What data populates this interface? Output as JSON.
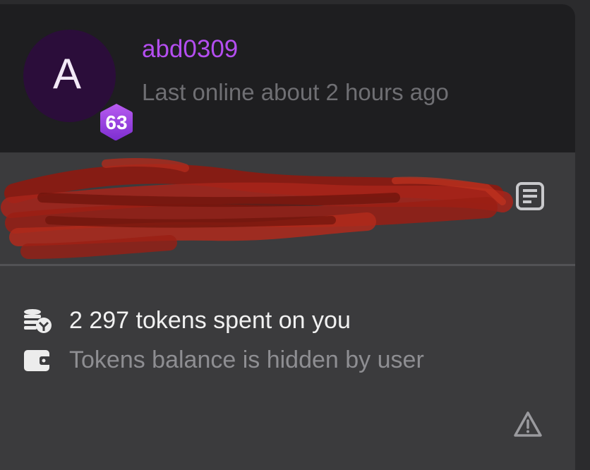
{
  "profile": {
    "avatar_letter": "A",
    "level": "63",
    "username": "abd0309",
    "last_online": "Last online about 2 hours ago"
  },
  "stats": {
    "tokens_spent": "2 297 tokens spent on you",
    "balance": "Tokens balance is hidden by user"
  },
  "icons": {
    "notes": "notes-icon",
    "coins": "coins-icon",
    "wallet": "wallet-icon",
    "warning": "warning-icon"
  },
  "colors": {
    "username": "#b44ef0",
    "badge": "#9b3fe0",
    "redaction": "#9c1a10"
  }
}
